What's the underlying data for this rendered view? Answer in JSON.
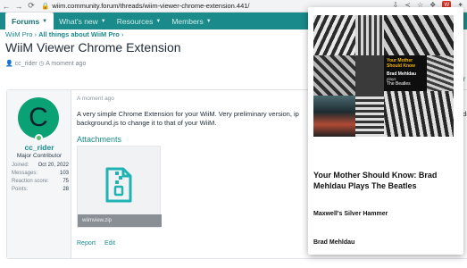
{
  "browser": {
    "url": "wiim.community.forum/threads/wiim-viewer-chrome-extension.441/",
    "back_icon": "arrow-left-icon",
    "forward_icon": "arrow-right-icon",
    "reload_icon": "reload-icon"
  },
  "nav": {
    "tabs": [
      {
        "label": "Forums",
        "active": true
      },
      {
        "label": "What's new",
        "active": false
      },
      {
        "label": "Resources",
        "active": false
      },
      {
        "label": "Members",
        "active": false
      }
    ]
  },
  "breadcrumb": {
    "items": [
      "WiiM Pro",
      "All things about WiiM Pro"
    ]
  },
  "thread": {
    "title": "WiiM Viewer Chrome Extension",
    "author": "cc_rider",
    "time": "A moment ago"
  },
  "post": {
    "avatar_letter": "C",
    "username": "cc_rider",
    "user_title": "Major Contributor",
    "stats": [
      {
        "label": "Joined:",
        "value": "Oct 20, 2022"
      },
      {
        "label": "Messages:",
        "value": "103"
      },
      {
        "label": "Reaction score:",
        "value": "75"
      },
      {
        "label": "Points:",
        "value": "28"
      }
    ],
    "time": "A moment ago",
    "body_line1": "A very simple Chrome Extension for your WiiM. Very preliminary version, ip",
    "body_line2": "background.js to change it to that of your WiiM.",
    "body_cut": "edi",
    "attachments_heading": "Attachments",
    "attachment_caption": "wiimview.zip",
    "actions": {
      "report": "Report",
      "edit": "Edit"
    }
  },
  "right_edge_text": "Ur",
  "popup": {
    "album_text": {
      "title": "Your Mother Should Know",
      "artist": "Brad Mehldau",
      "plays": "plays",
      "band": "The Beatles"
    },
    "title": "Your Mother Should Know: Brad Mehldau Plays The Beatles",
    "track": "Maxwell's Silver Hammer",
    "artist": "Brad Mehldau"
  },
  "colors": {
    "nav_bg": "#1a8a8a",
    "accent": "#1a8a8a",
    "avatar_bg": "#0aa174"
  }
}
